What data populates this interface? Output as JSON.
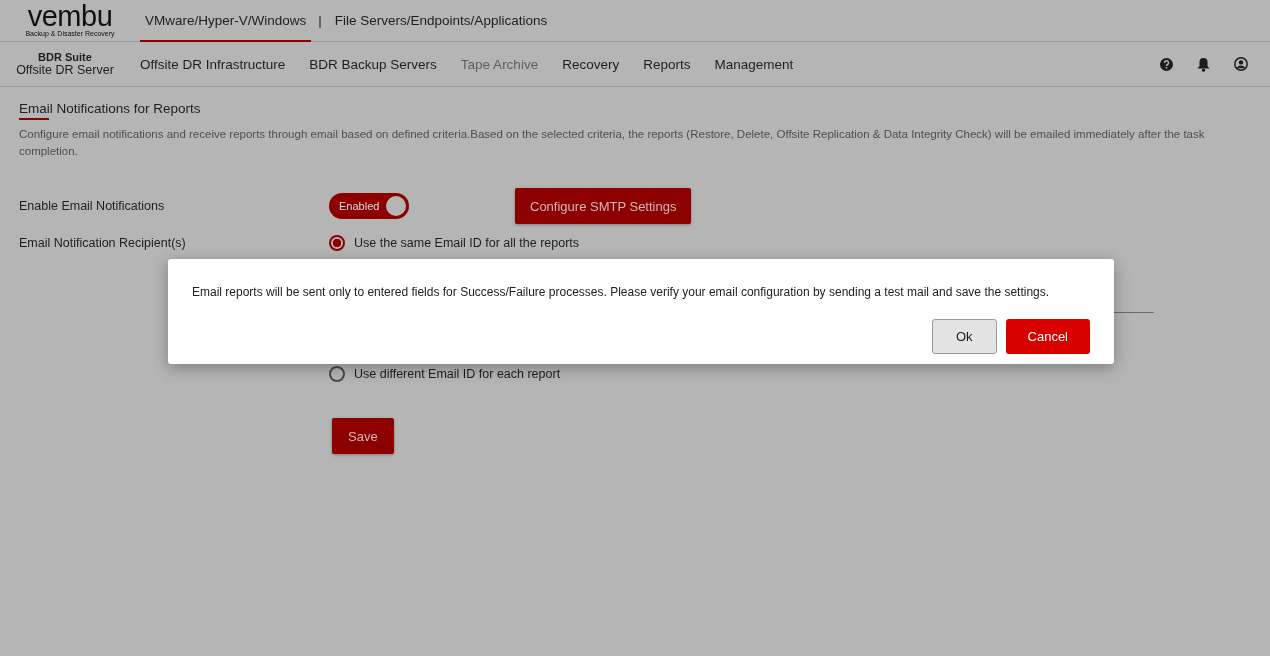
{
  "logo": {
    "name": "vembu",
    "tagline": "Backup & Disaster Recovery"
  },
  "product_tabs": [
    {
      "label": "VMware/Hyper-V/Windows",
      "selected": true
    },
    {
      "label": "File Servers/Endpoints/Applications",
      "selected": false
    }
  ],
  "product_separator": "|",
  "suite": {
    "title": "BDR Suite",
    "subtitle": "Offsite DR Server"
  },
  "nav": [
    {
      "label": "Offsite DR Infrastructure",
      "disabled": false
    },
    {
      "label": "BDR Backup Servers",
      "disabled": false
    },
    {
      "label": "Tape Archive",
      "disabled": true
    },
    {
      "label": "Recovery",
      "disabled": false
    },
    {
      "label": "Reports",
      "disabled": false
    },
    {
      "label": "Management",
      "disabled": false
    }
  ],
  "page": {
    "title": "Email Notifications for Reports",
    "description": "Configure email notifications and receive reports through email based on defined criteria.Based on the selected criteria, the reports (Restore, Delete, Offsite Replication & Data Integrity Check) will be emailed immediately after the task completion."
  },
  "enable_row": {
    "label": "Enable Email Notifications",
    "toggle": {
      "label": "Enabled",
      "on": true
    },
    "button": "Configure SMTP Settings"
  },
  "recipient_row": {
    "label": "Email Notification Recipient(s)",
    "options": [
      {
        "label": "Use the same Email ID for all the reports",
        "selected": true
      },
      {
        "label": "Use different Email ID for each report",
        "selected": false
      }
    ]
  },
  "save_button": "Save",
  "dialog": {
    "message": "Email reports will be sent only to entered fields for Success/Failure processes. Please verify your email configuration by sending a test mail and save the settings.",
    "buttons": [
      {
        "label": "Ok",
        "kind": "secondary"
      },
      {
        "label": "Cancel",
        "kind": "primary"
      }
    ]
  }
}
